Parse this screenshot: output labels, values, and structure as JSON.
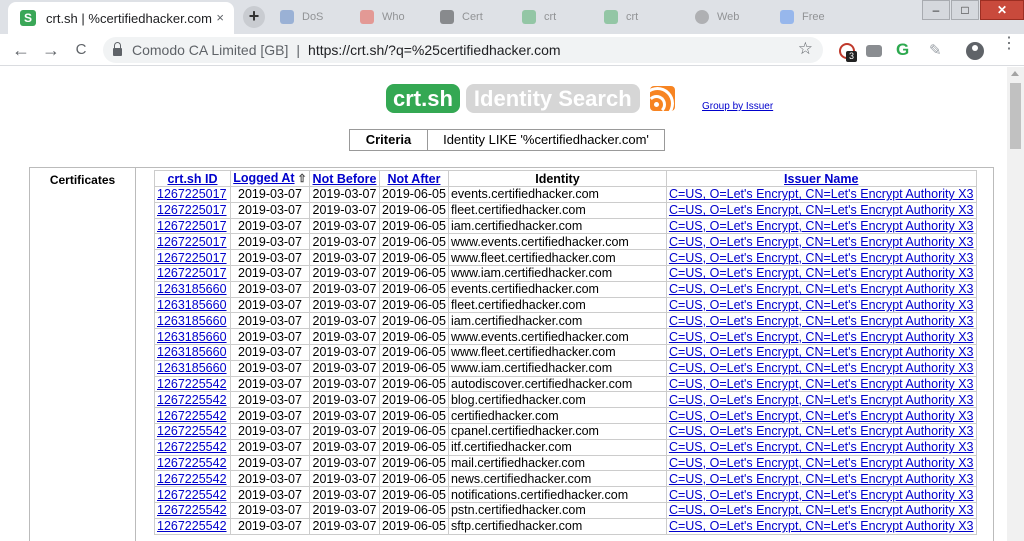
{
  "browser": {
    "tab_title": "crt.sh | %certifiedhacker.com",
    "favicon_letter": "S",
    "bg_tabs": [
      "DoS",
      "Who",
      "Cert",
      "crt",
      "crt",
      "Web",
      "Free"
    ],
    "newtab_label": "+",
    "back_label": "←",
    "forward_label": "→",
    "reload_label": "C",
    "close_tab_label": "×",
    "org_label": "Comodo CA Limited [GB]",
    "separator": "|",
    "url": "https://crt.sh/?q=%25certifiedhacker.com",
    "ext_badge": "3",
    "ext_g_label": "G",
    "star_label": "☆",
    "win_min": "–",
    "win_max": "□",
    "win_close": "✕",
    "menu_label": "⋮"
  },
  "page": {
    "logo_text": "crt.sh",
    "identity_search_label": "Identity Search",
    "group_by_issuer": "Group by Issuer",
    "criteria_label": "Criteria",
    "criteria_value": "Identity LIKE '%certifiedhacker.com'",
    "section_label": "Certificates",
    "columns": {
      "id": "crt.sh ID",
      "logged_at": "Logged At",
      "sort_arrow": "⇧",
      "not_before": "Not Before",
      "not_after": "Not After",
      "identity": "Identity",
      "issuer": "Issuer Name"
    },
    "rows": [
      {
        "id": "1267225017",
        "logged": "2019-03-07",
        "nb": "2019-03-07",
        "na": "2019-06-05",
        "identity": "events.certifiedhacker.com",
        "issuer": "C=US, O=Let's Encrypt, CN=Let's Encrypt Authority X3"
      },
      {
        "id": "1267225017",
        "logged": "2019-03-07",
        "nb": "2019-03-07",
        "na": "2019-06-05",
        "identity": "fleet.certifiedhacker.com",
        "issuer": "C=US, O=Let's Encrypt, CN=Let's Encrypt Authority X3"
      },
      {
        "id": "1267225017",
        "logged": "2019-03-07",
        "nb": "2019-03-07",
        "na": "2019-06-05",
        "identity": "iam.certifiedhacker.com",
        "issuer": "C=US, O=Let's Encrypt, CN=Let's Encrypt Authority X3"
      },
      {
        "id": "1267225017",
        "logged": "2019-03-07",
        "nb": "2019-03-07",
        "na": "2019-06-05",
        "identity": "www.events.certifiedhacker.com",
        "issuer": "C=US, O=Let's Encrypt, CN=Let's Encrypt Authority X3"
      },
      {
        "id": "1267225017",
        "logged": "2019-03-07",
        "nb": "2019-03-07",
        "na": "2019-06-05",
        "identity": "www.fleet.certifiedhacker.com",
        "issuer": "C=US, O=Let's Encrypt, CN=Let's Encrypt Authority X3"
      },
      {
        "id": "1267225017",
        "logged": "2019-03-07",
        "nb": "2019-03-07",
        "na": "2019-06-05",
        "identity": "www.iam.certifiedhacker.com",
        "issuer": "C=US, O=Let's Encrypt, CN=Let's Encrypt Authority X3"
      },
      {
        "id": "1263185660",
        "logged": "2019-03-07",
        "nb": "2019-03-07",
        "na": "2019-06-05",
        "identity": "events.certifiedhacker.com",
        "issuer": "C=US, O=Let's Encrypt, CN=Let's Encrypt Authority X3"
      },
      {
        "id": "1263185660",
        "logged": "2019-03-07",
        "nb": "2019-03-07",
        "na": "2019-06-05",
        "identity": "fleet.certifiedhacker.com",
        "issuer": "C=US, O=Let's Encrypt, CN=Let's Encrypt Authority X3"
      },
      {
        "id": "1263185660",
        "logged": "2019-03-07",
        "nb": "2019-03-07",
        "na": "2019-06-05",
        "identity": "iam.certifiedhacker.com",
        "issuer": "C=US, O=Let's Encrypt, CN=Let's Encrypt Authority X3"
      },
      {
        "id": "1263185660",
        "logged": "2019-03-07",
        "nb": "2019-03-07",
        "na": "2019-06-05",
        "identity": "www.events.certifiedhacker.com",
        "issuer": "C=US, O=Let's Encrypt, CN=Let's Encrypt Authority X3"
      },
      {
        "id": "1263185660",
        "logged": "2019-03-07",
        "nb": "2019-03-07",
        "na": "2019-06-05",
        "identity": "www.fleet.certifiedhacker.com",
        "issuer": "C=US, O=Let's Encrypt, CN=Let's Encrypt Authority X3"
      },
      {
        "id": "1263185660",
        "logged": "2019-03-07",
        "nb": "2019-03-07",
        "na": "2019-06-05",
        "identity": "www.iam.certifiedhacker.com",
        "issuer": "C=US, O=Let's Encrypt, CN=Let's Encrypt Authority X3"
      },
      {
        "id": "1267225542",
        "logged": "2019-03-07",
        "nb": "2019-03-07",
        "na": "2019-06-05",
        "identity": "autodiscover.certifiedhacker.com",
        "issuer": "C=US, O=Let's Encrypt, CN=Let's Encrypt Authority X3"
      },
      {
        "id": "1267225542",
        "logged": "2019-03-07",
        "nb": "2019-03-07",
        "na": "2019-06-05",
        "identity": "blog.certifiedhacker.com",
        "issuer": "C=US, O=Let's Encrypt, CN=Let's Encrypt Authority X3"
      },
      {
        "id": "1267225542",
        "logged": "2019-03-07",
        "nb": "2019-03-07",
        "na": "2019-06-05",
        "identity": "certifiedhacker.com",
        "issuer": "C=US, O=Let's Encrypt, CN=Let's Encrypt Authority X3"
      },
      {
        "id": "1267225542",
        "logged": "2019-03-07",
        "nb": "2019-03-07",
        "na": "2019-06-05",
        "identity": "cpanel.certifiedhacker.com",
        "issuer": "C=US, O=Let's Encrypt, CN=Let's Encrypt Authority X3"
      },
      {
        "id": "1267225542",
        "logged": "2019-03-07",
        "nb": "2019-03-07",
        "na": "2019-06-05",
        "identity": "itf.certifiedhacker.com",
        "issuer": "C=US, O=Let's Encrypt, CN=Let's Encrypt Authority X3"
      },
      {
        "id": "1267225542",
        "logged": "2019-03-07",
        "nb": "2019-03-07",
        "na": "2019-06-05",
        "identity": "mail.certifiedhacker.com",
        "issuer": "C=US, O=Let's Encrypt, CN=Let's Encrypt Authority X3"
      },
      {
        "id": "1267225542",
        "logged": "2019-03-07",
        "nb": "2019-03-07",
        "na": "2019-06-05",
        "identity": "news.certifiedhacker.com",
        "issuer": "C=US, O=Let's Encrypt, CN=Let's Encrypt Authority X3"
      },
      {
        "id": "1267225542",
        "logged": "2019-03-07",
        "nb": "2019-03-07",
        "na": "2019-06-05",
        "identity": "notifications.certifiedhacker.com",
        "issuer": "C=US, O=Let's Encrypt, CN=Let's Encrypt Authority X3"
      },
      {
        "id": "1267225542",
        "logged": "2019-03-07",
        "nb": "2019-03-07",
        "na": "2019-06-05",
        "identity": "pstn.certifiedhacker.com",
        "issuer": "C=US, O=Let's Encrypt, CN=Let's Encrypt Authority X3"
      },
      {
        "id": "1267225542",
        "logged": "2019-03-07",
        "nb": "2019-03-07",
        "na": "2019-06-05",
        "identity": "sftp.certifiedhacker.com",
        "issuer": "C=US, O=Let's Encrypt, CN=Let's Encrypt Authority X3"
      }
    ]
  },
  "colors": {
    "logo_green": "#34a853",
    "link_blue": "#0000cc",
    "visited_purple": "#551a8b",
    "rss_orange": "#f78422"
  }
}
